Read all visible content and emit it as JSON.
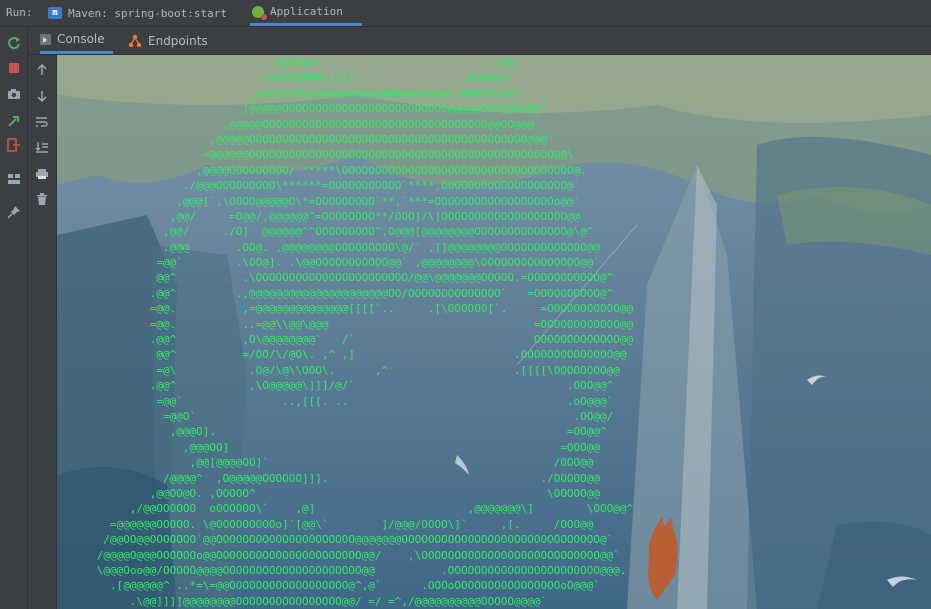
{
  "run_bar": {
    "label": "Run:",
    "tabs": [
      {
        "label": "Maven: spring-boot:start",
        "icon": "maven-icon",
        "active": false
      },
      {
        "label": "Application",
        "icon": "spring-boot-icon",
        "active": true
      }
    ]
  },
  "sub_tabs": {
    "console": "Console",
    "endpoints": "Endpoints"
  },
  "left_toolbar": [
    "rerun-icon",
    "stop-icon",
    "camera-icon",
    "restore-layout-icon",
    "exit-icon",
    "layout-icon",
    "pin-icon"
  ],
  "console_toolbar": [
    "up-arrow-icon",
    "down-arrow-icon",
    "soft-wrap-icon",
    "scroll-to-end-icon",
    "print-icon",
    "trash-icon"
  ],
  "colors": {
    "ascii_text": "#35e86a",
    "accent": "#4a88c7",
    "panel": "#3c3f41"
  },
  "console_lines": [
    "                                .@@@0@@\\                         ,/@@`",
    "                               /@@OO@@@@]]]]]`..             ,@@@@@@`",
    "                             ,@@@OOOOO@@@@@@@@@@@@@@@@@@@@@\\]@@@OOO@@\\",
    "                            ]@@@@@OOOOOOOOOOOOOOOOOOOOOOOOO@@@@@OOO@@OO@@^",
    "                         ,@@@@@OOOOOOOOOOOOOOOOOOOOOOOOOOOOOOOOOO@@OO@@@`",
    "                       ,@@@@@OOOOOOOOOOOOOOOOOOOOOOOOOOOOOOOOOOOOOOOOOO@@@`",
    "                      =@@@@@@OOOOOOOOOOOOOOOOOOOOOOOOOOOOOOOOOOOOOOOOOOOOOO@@\\",
    "                     ,@@@@OOOOOOOOO/`*****\\OOOOOOOOOOOOOOOOOOOOOOOOOOOOOOOOOOO@.",
    "                   ./@@@OOOOOOOOO\\******=OOOOOOOOOOO`****,OOOOOOOOOOOOOOOOOOO@`",
    "                  ,@@@[`,\\OOOO@@@@@O\\*=OOOOOOOOO`**,`***=OOOOOOOOOOOOOOOOOOo@@`",
    "                 ,@@/     =O@@/,@@@@@@^=OOOOOOOO**/OOO]/\\]OOOOOOOOOOOOOOOOOOO@@",
    "                ,@@/     ./O]  @@@@@@^^OOOOOOOOO^,O@@@[@@@@@@@@OOOOOOOOOOOOOO@\\@^",
    "                .@@@       .OO@. ,@@@@@@@@OOOOOOOOO\\@/` ,]]@@@@@@@@OOOOOOOOOOOOO@@",
    "               =@@`        .\\OO@]. .\\@@OOOOOOOOOOO@@` ,@@@@@@@@\\OOOOOOOOOOOOOOO@@`",
    "               @@^          .\\OOOOOOOOOOOOOOOOOOOOOOO/@@\\@@@@@@@OOOOO.=OOOOOOOOOOO@^",
    "              .@@^         .,@@@@@@@@@@@@@@@@@@@@@OO/OOOOOOOOOOOOOO`   =OOOOOOOOOO@^",
    "              =@@.          ,=@@@@@@@@@@@@@@[[[[`..     .[\\OOOOOO[`.     =OOOOOOOOOOO@@",
    "              =@@.          ..=@@\\\\@@\\@@@                               =OOOOOOOOOOOO@@",
    "              .@@^          ,O\\@@@@@@@@`   /`                           OOOOOOOOOOOOO@@",
    "               @@^          =/OO/\\/@O\\. ,^ ,]                        .OOOOOOOOOOOOOO@@",
    "               =@\\           .O@/\\@\\\\OOO\\.      ,^                   .[[[[\\OOOOOOOO@@",
    "              .@@^           ,\\O@@@@@\\]]]/@/`                                .OOO@@^",
    "               =@@`               ..,[[[. ..                                 .oO@@@`",
    "                =@@O`                                                         .OO@@/",
    "                 ,@@@O].                                                     =OO@@^",
    "                   ,@@@OO]                                                  =OOO@@",
    "                    ,@@[@@@@OO]`                                           /OOO@@",
    "                /@@@@^  ,O@@@@@OOOOOO]]].                                ./OOOOO@@",
    "              ,@@OO@O. ,OOOOO^                                            \\OOOOO@@",
    "           ,/@@OOOOOO  oOOOOOO\\`    ,@]                       ,@@@@@@@\\]        \\OOO@@^",
    "        =@@@@@@OOOOO. \\@OOOOOOOOOo]`[@@\\`        ]/@@@/OOOO\\]`     ,[.     /OOO@@",
    "       /@@OO@@OOOOOOO`@@OOOOOOOOOOOOOOOOOOOOO@@@@@@@OOOOOOOOOOOOOOOOOOOOOOOOOOOOOO@`",
    "      /@@@@O@@@OOOOOOo@@OOOOOOOOOOOOOOOOOOOOOO@@/    ,\\OOOOOOOOOOOOOOOOOOOOOOOOOOO@@`",
    "      \\@@@Ooo@@/OOOOO@@@@OOOOOOOOOOOOOOOOOOOOO@@          .OOOOOOOOOOOOOOOOOOOOOOO@@@.",
    "        .[@@@@@@^ ..*=\\=@@OOOOOOOOOOOOOOOOOO@^,@`      .OOOoOOOOOOOOOOOOOOOOoO@@@`",
    "           .\\@@]]]]@@@@@@@@OOOOOOOOOOOOOOOO@@/ =/ =^,/@@@@@@@@@@OOOOO@@@@`",
    "              .[@@/[[.   ,[@@@@@@@@@@@@@@@@@@@@[`   .@\\  [[@@@@@["
  ]
}
